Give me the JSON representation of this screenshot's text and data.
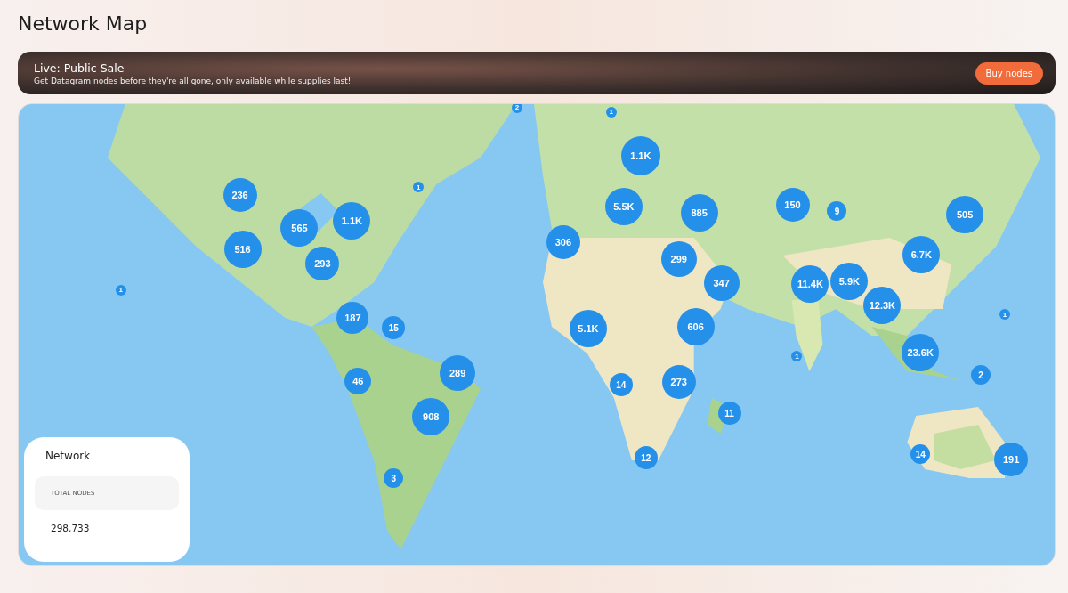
{
  "page_title": "Network Map",
  "banner": {
    "title": "Live: Public Sale",
    "subtitle": "Get Datagram nodes before they're all gone, only available while supplies last!",
    "button": "Buy nodes"
  },
  "map": {
    "kind": "picture",
    "clusters": [
      {
        "count": "2"
      },
      {
        "count": "1"
      },
      {
        "count": "1.1K"
      },
      {
        "count": "236"
      },
      {
        "count": "1"
      },
      {
        "count": "565"
      },
      {
        "count": "1.1K"
      },
      {
        "count": "5.5K"
      },
      {
        "count": "885"
      },
      {
        "count": "150"
      },
      {
        "count": "9"
      },
      {
        "count": "505"
      },
      {
        "count": "516"
      },
      {
        "count": "306"
      },
      {
        "count": "293"
      },
      {
        "count": "299"
      },
      {
        "count": "6.7K"
      },
      {
        "count": "347"
      },
      {
        "count": "1"
      },
      {
        "count": "11.4K"
      },
      {
        "count": "5.9K"
      },
      {
        "count": "12.3K"
      },
      {
        "count": "1"
      },
      {
        "count": "187"
      },
      {
        "count": "15"
      },
      {
        "count": "5.1K"
      },
      {
        "count": "606"
      },
      {
        "count": "23.6K"
      },
      {
        "count": "1"
      },
      {
        "count": "289"
      },
      {
        "count": "46"
      },
      {
        "count": "14"
      },
      {
        "count": "273"
      },
      {
        "count": "2"
      },
      {
        "count": "11"
      },
      {
        "count": "908"
      },
      {
        "count": "14"
      },
      {
        "count": "191"
      },
      {
        "count": "12"
      },
      {
        "count": "3"
      }
    ]
  },
  "network_card": {
    "title": "Network",
    "stat_label": "TOTAL NODES",
    "stat_value": "298,733"
  }
}
